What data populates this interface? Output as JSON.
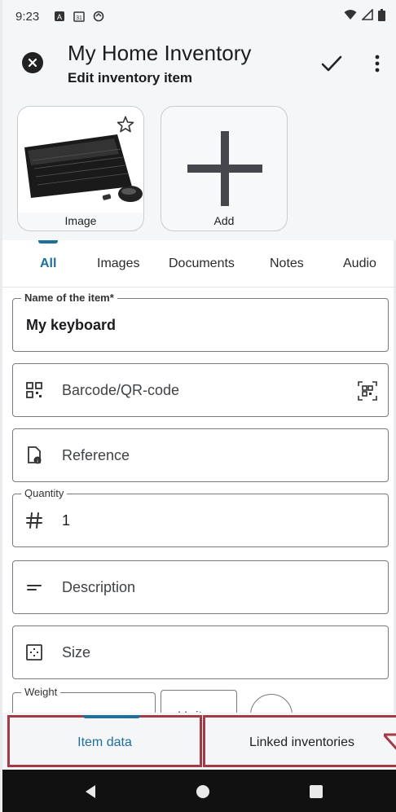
{
  "status_bar": {
    "time": "9:23",
    "left_icons": [
      "notification-a-icon",
      "calendar-31-icon",
      "sync-icon"
    ],
    "right_icons": [
      "wifi-icon",
      "signal-icon",
      "battery-icon"
    ]
  },
  "app_bar": {
    "title": "My Home Inventory",
    "subtitle": "Edit inventory item",
    "close_icon": "close-circle-icon",
    "confirm_icon": "check-icon",
    "more_icon": "more-vert-icon"
  },
  "images": [
    {
      "label": "Image",
      "kind": "keyboard-photo",
      "starred": false
    },
    {
      "label": "Add",
      "kind": "add-plus-icon"
    }
  ],
  "tabs": {
    "items": [
      "All",
      "Images",
      "Documents",
      "Notes",
      "Audio"
    ],
    "active": "All"
  },
  "fields": {
    "name": {
      "label": "Name of the item*",
      "value": "My keyboard"
    },
    "barcode": {
      "placeholder": "Barcode/QR-code",
      "icon": "qr-code-icon",
      "scan_icon": "qr-scan-icon"
    },
    "reference": {
      "placeholder": "Reference",
      "icon": "document-reference-icon"
    },
    "quantity": {
      "label": "Quantity",
      "value": "1",
      "icon": "hash-icon"
    },
    "description": {
      "placeholder": "Description",
      "icon": "short-text-icon"
    },
    "size": {
      "placeholder": "Size",
      "icon": "size-box-icon"
    },
    "weight": {
      "label": "Weight",
      "unit_label": "Unit"
    }
  },
  "bottom_nav": {
    "items": [
      "Item data",
      "Linked inventories"
    ],
    "active": "Item data"
  },
  "colors": {
    "accent": "#1f6f9a",
    "highlight_border": "#a33a45",
    "surface": "#f4f6f8"
  }
}
